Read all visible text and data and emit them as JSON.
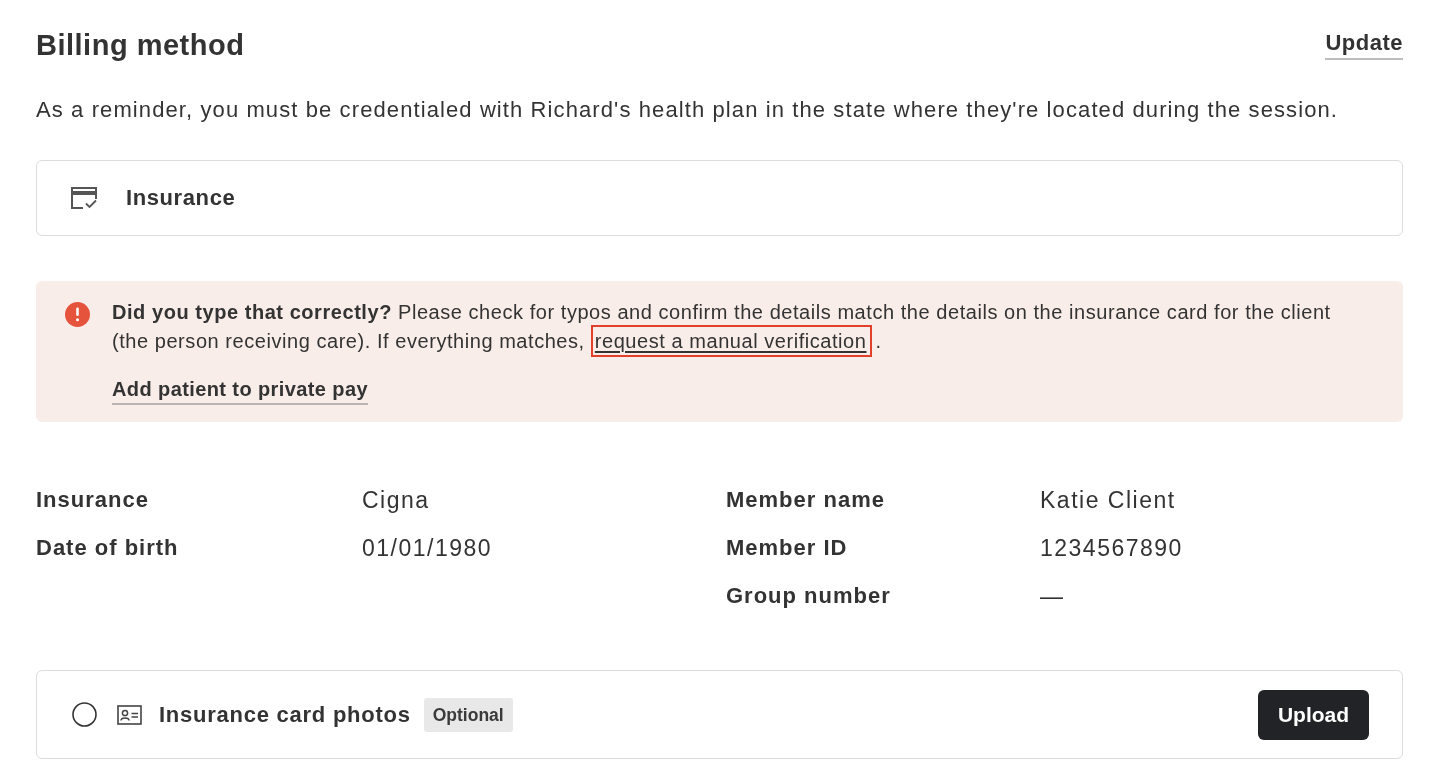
{
  "header": {
    "title": "Billing method",
    "action": "Update"
  },
  "reminder": "As a reminder, you must be credentialed with Richard's health plan in the state where they're located during the session.",
  "billing_option": {
    "label": "Insurance"
  },
  "alert": {
    "kind": "error",
    "message": "**Did you type that correctly?** Please check for typos and confirm the details match the details on the insurance card for the client (the person receiving care). If everything matches, ",
    "link": {
      "label": "request a manual verification",
      "highlighted": true
    },
    "message_end": ".",
    "action": "Add patient to private pay"
  },
  "details": {
    "left": [
      {
        "label": "Insurance",
        "value": "Cigna"
      },
      {
        "label": "Date of birth",
        "value": "01/01/1980"
      }
    ],
    "right": [
      {
        "label": "Member name",
        "value": "Katie Client"
      },
      {
        "label": "Member ID",
        "value": "1234567890"
      },
      {
        "label": "Group number",
        "value": "—"
      }
    ]
  },
  "card_photos": {
    "selected": false,
    "label": "Insurance card photos",
    "badge": "Optional",
    "button": "Upload"
  }
}
